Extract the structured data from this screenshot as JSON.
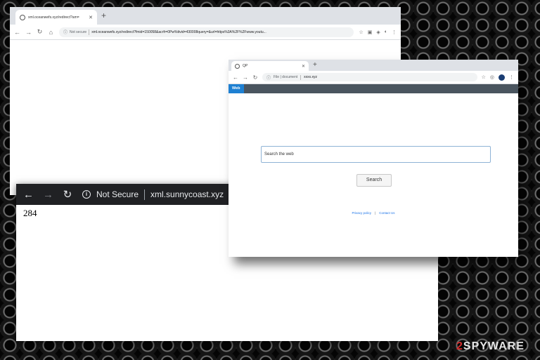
{
  "window_back": {
    "tab_title": "xml.oceanwefs.xyz/redirect?am=",
    "url_security": "Not secure",
    "url": "xml.oceanwefs.xyz/redirect?fmid=150058&acrfr=0Pw%ttvid=430008query=&url=https%3A%2F%2Fwww.youtu..."
  },
  "window_front": {
    "tab_title": "QP",
    "url_security": "File | document",
    "url": "xxxx.xyz",
    "nav_tab": "Web",
    "search_placeholder": "Search the web",
    "search_button": "Search",
    "footer_links": [
      "Privacy policy",
      "Contact Us"
    ],
    "footer_separator": "|"
  },
  "window_dark": {
    "url_security": "Not Secure",
    "url": "xml.sunnycoast.xyz",
    "body_text": "284"
  },
  "watermark": {
    "prefix": "2",
    "suffix": "SPYWARE"
  },
  "icons": {
    "back": "back-arrow-icon",
    "forward": "forward-arrow-icon",
    "reload": "reload-icon",
    "info": "info-icon"
  },
  "colors": {
    "web_tab": "#1e80d2",
    "nav_bar": "#4a555f",
    "dark_toolbar": "#202124",
    "search_border": "#8fb3d6",
    "watermark_red": "#d12b2b"
  }
}
